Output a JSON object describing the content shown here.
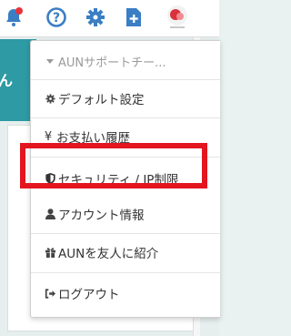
{
  "topbar": {
    "icons": [
      "bell-icon",
      "help-icon",
      "gear-icon",
      "add-document-icon",
      "account-logo"
    ],
    "notification_dot_color": "#e8323c",
    "icon_color": "#3a7ec4"
  },
  "background": {
    "teal_text": "ん"
  },
  "dropdown": {
    "header_label": "AUNサポートチー...",
    "items": [
      {
        "label": "デフォルト設定",
        "icon": "gear-icon"
      },
      {
        "label": "お支払い履歴",
        "icon": "yen-icon"
      },
      {
        "label": "セキュリティ / IP制限",
        "icon": "shield-icon"
      },
      {
        "label": "アカウント情報",
        "icon": "user-icon"
      },
      {
        "label": "AUNを友人に紹介",
        "icon": "gift-icon"
      },
      {
        "label": "ログアウト",
        "icon": "sign-out-icon"
      }
    ]
  },
  "highlight_color": "#e3151f"
}
